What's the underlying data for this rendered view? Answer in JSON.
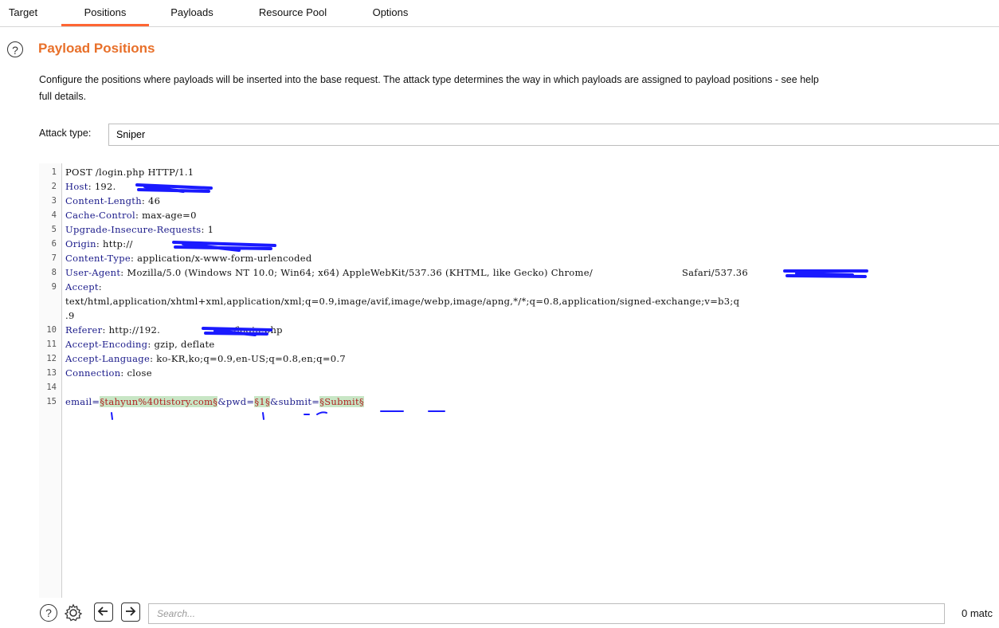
{
  "tabs": [
    "Target",
    "Positions",
    "Payloads",
    "Resource Pool",
    "Options"
  ],
  "active_tab": "Positions",
  "section": {
    "title": "Payload Positions",
    "help_icon": "?",
    "description_line1": "Configure the positions where payloads will be inserted into the base request. The attack type determines the way in which payloads are assigned to payload positions - see help",
    "description_line2": "full details."
  },
  "attack": {
    "label": "Attack type:",
    "value": "Sniper"
  },
  "request": {
    "line_numbers": [
      "1",
      "2",
      "3",
      "4",
      "5",
      "6",
      "7",
      "8",
      "9",
      "",
      "",
      "10",
      "11",
      "12",
      "13",
      "14",
      "15"
    ],
    "l1": "POST /login.php HTTP/1.1",
    "l2_name": "Host",
    "l2_value": ": 192.",
    "l3_name": "Content-Length",
    "l3_value": ": 46",
    "l4_name": "Cache-Control",
    "l4_value": ": max-age=0",
    "l5_name": "Upgrade-Insecure-Requests",
    "l5_value": ": 1",
    "l6_name": "Origin",
    "l6_value": ": http://",
    "l7_name": "Content-Type",
    "l7_value": ": application/x-www-form-urlencoded",
    "l8_name": "User-Agent",
    "l8_value": ": Mozilla/5.0 (Windows NT 10.0; Win64; x64) AppleWebKit/537.36 (KHTML, like Gecko) Chrome/",
    "l8_tail": " Safari/537.36",
    "l9_name": "Accept",
    "l9_value": ":",
    "l9_cont1": "text/html,application/xhtml+xml,application/xml;q=0.9,image/avif,image/webp,image/apng,*/*;q=0.8,application/signed-exchange;v=b3;q",
    "l9_cont2": ".9",
    "l10_name": "Referer",
    "l10_value": ": http://192.",
    "l10_tail": "/login.php",
    "l11_name": "Accept-Encoding",
    "l11_value": ": gzip, deflate",
    "l12_name": "Accept-Language",
    "l12_value": ": ko-KR,ko;q=0.9,en-US;q=0.8,en;q=0.7",
    "l13_name": "Connection",
    "l13_value": ": close",
    "body_p1": "email=",
    "body_m1": "§tahyun%40tistory.com§",
    "body_p2": "&pwd=",
    "body_m2": "§1§",
    "body_p3": "&submit=",
    "body_m3": "§Submit§"
  },
  "search": {
    "placeholder": "Search...",
    "matches": "0 matc"
  },
  "icons": [
    "help-icon",
    "gear-icon",
    "arrow-left-icon",
    "arrow-right-icon"
  ],
  "colors": {
    "accent": "#e8702a",
    "tab_underline": "#ff6633",
    "marker_bg": "#c8e6c5",
    "marker_fg": "#b02020",
    "header_name": "#1a1a8a",
    "redaction": "#1a1aff"
  }
}
